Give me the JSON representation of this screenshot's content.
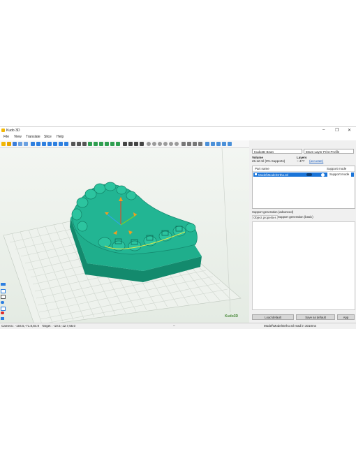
{
  "window": {
    "title": "Kudo 3D"
  },
  "menu": [
    "File",
    "View",
    "Translate",
    "Slice",
    "Help"
  ],
  "panel": {
    "printer": "Kudo3D Bean",
    "profile": "50um Layer Print Profile",
    "volume_label": "Volume",
    "volume_value": "26.12 ml (0% Supports)",
    "layers_label": "Layers",
    "layers_value": "~ 477",
    "layers_link": "(accurate)",
    "table": {
      "col_part": "Part name",
      "col_support": "Support mode",
      "row_name": "Model\\ModelOrtho.stl",
      "row_support": "Support mode"
    },
    "tab_advanced": "Support generation (advanced)",
    "tab_object": "Object properties",
    "tab_basic": "Support generation (basic)",
    "btn_load": "Load default",
    "btn_save": "Save as default",
    "btn_apply": "App"
  },
  "status": {
    "camera": "Camera : -104.5,-71.8,84.9",
    "target": "Target : -10.5,-12.7,55.0",
    "sep": "--",
    "message": "Model\\ModelOrtho.stl read in 3010ms"
  },
  "brand": "Kudo3D",
  "colors": {
    "model": "#1fae8c",
    "model_dark": "#138a6d",
    "selection": "#1a74d8"
  }
}
